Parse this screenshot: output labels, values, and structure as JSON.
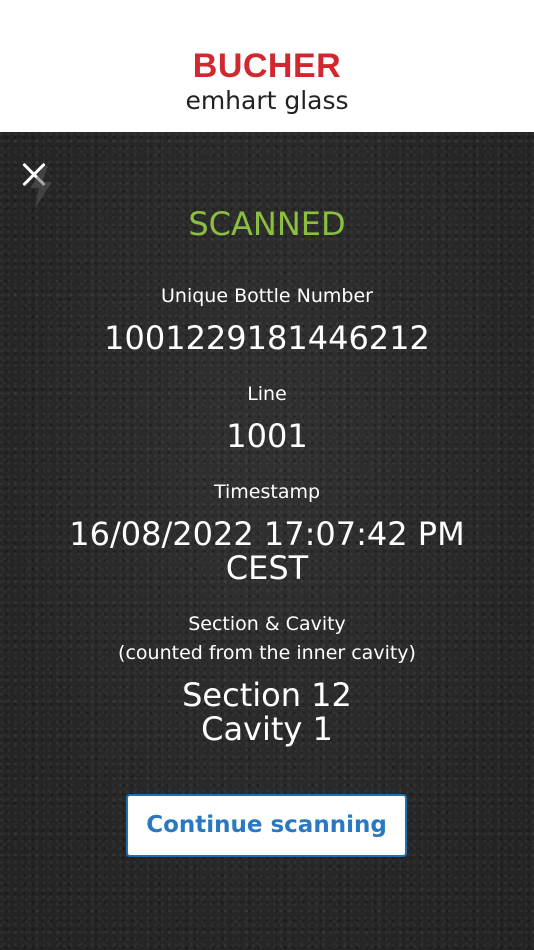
{
  "header": {
    "brand": "BUCHER",
    "sub_brand": "emhart glass"
  },
  "result": {
    "status": "SCANNED",
    "unique_bottle_number_label": "Unique Bottle Number",
    "unique_bottle_number": "1001229181446212",
    "line_label": "Line",
    "line": "1001",
    "timestamp_label": "Timestamp",
    "timestamp_line1": "16/08/2022 17:07:42 PM",
    "timestamp_line2": "CEST",
    "section_cavity_label": "Section & Cavity",
    "section_cavity_note": "(counted from the inner cavity)",
    "section": "Section 12",
    "cavity": "Cavity 1"
  },
  "actions": {
    "close_icon": "close-icon",
    "flash_icon": "flash-icon",
    "continue_label": "Continue scanning"
  },
  "colors": {
    "brand_red": "#d1272f",
    "status_green": "#8cbf3f",
    "button_blue": "#2a78c0",
    "panel_background": "#2b2b2b"
  }
}
